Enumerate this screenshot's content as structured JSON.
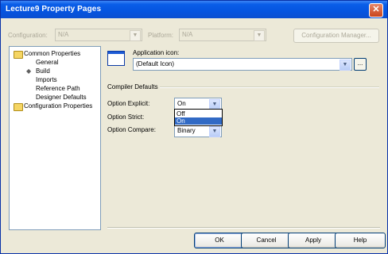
{
  "window": {
    "title": "Lecture9 Property Pages",
    "close_glyph": "✕"
  },
  "toolbar": {
    "configuration_label": "Configuration:",
    "configuration_value": "N/A",
    "platform_label": "Platform:",
    "platform_value": "N/A",
    "config_manager_label": "Configuration Manager..."
  },
  "tree": {
    "root_common": "Common Properties",
    "children": [
      "General",
      "Build",
      "Imports",
      "Reference Path",
      "Designer Defaults"
    ],
    "root_config": "Configuration Properties",
    "selected_marker": "◆"
  },
  "app_icon": {
    "label": "Application icon:",
    "value": "(Default Icon)",
    "browse_label": "..."
  },
  "compiler": {
    "section_label": "Compiler Defaults",
    "explicit_label": "Option Explicit:",
    "explicit_value": "On",
    "explicit_options": [
      "Off",
      "On"
    ],
    "strict_label": "Option Strict:",
    "compare_label": "Option Compare:",
    "compare_value": "Binary"
  },
  "buttons": {
    "ok": "OK",
    "cancel": "Cancel",
    "apply": "Apply",
    "help": "Help"
  },
  "colors": {
    "title_bar": "#0554e0",
    "selection": "#316ac5",
    "dialog_bg": "#ece9d8"
  }
}
